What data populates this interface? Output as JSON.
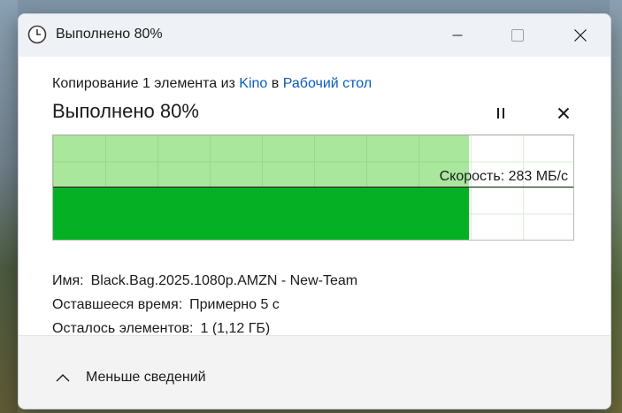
{
  "window": {
    "title": "Выполнено 80%"
  },
  "copy": {
    "prefix": "Копирование 1 элемента из",
    "source": "Kino",
    "connector": "в",
    "destination": "Рабочий стол",
    "heading": "Выполнено 80%",
    "progress_fraction": 0.8
  },
  "graph": {
    "speed_label": "Скорость: 283 МБ/с",
    "speed_level_fraction": 0.5,
    "fill_color": "#06b025",
    "done_color": "#a9e79d"
  },
  "details": {
    "name_key": "Имя:",
    "name_value": "Black.Bag.2025.1080p.AMZN - New-Team",
    "time_key": "Оставшееся время:",
    "time_value": "Примерно 5 с",
    "items_key": "Осталось элементов:",
    "items_value": "1 (1,12 ГБ)"
  },
  "footer": {
    "less_label": "Меньше сведений"
  }
}
